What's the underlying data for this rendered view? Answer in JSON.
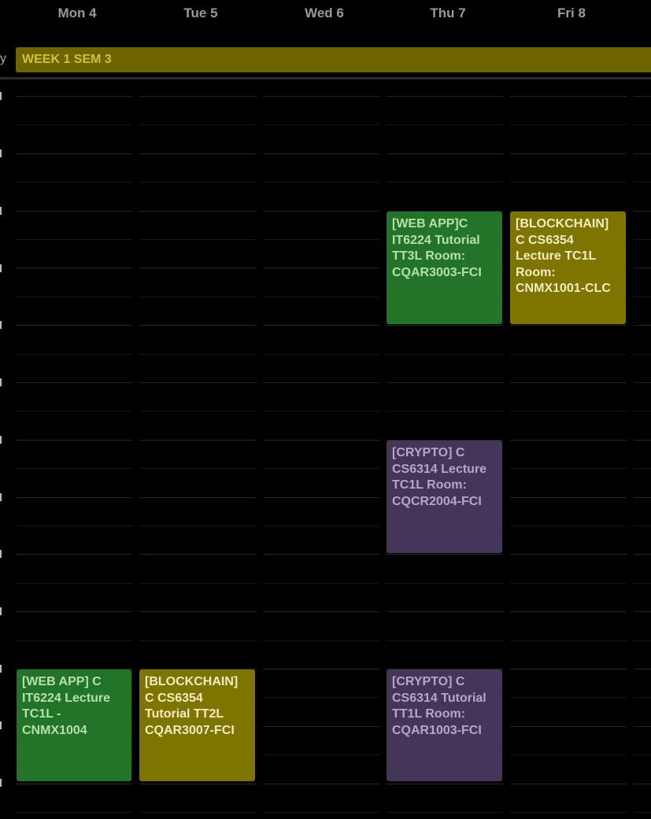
{
  "days": [
    "Mon 4",
    "Tue 5",
    "Wed 6",
    "Thu 7",
    "Fri 8"
  ],
  "all_day": {
    "label": "y",
    "event_title": "WEEK 1 SEM 3",
    "color": "#6e6400"
  },
  "events": [
    {
      "day": "Thu 7",
      "text": "[WEB APP]C IT6224 Tutorial TT3L  Room: CQAR3003-FCI",
      "color": "#237428"
    },
    {
      "day": "Fri 8",
      "text": "[BLOCKCHAIN] C CS6354 Lecture TC1L Room: CNMX1001-CLC",
      "color": "#7e7500"
    },
    {
      "day": "Thu 7",
      "text": "[CRYPTO] C CS6314 Lecture TC1L Room: CQCR2004-FCI",
      "color": "#453558"
    },
    {
      "day": "Mon 4",
      "text": "[WEB APP] C IT6224 Lecture TC1L - CNMX1004",
      "color": "#237428"
    },
    {
      "day": "Tue 5",
      "text": "[BLOCKCHAIN] C CS6354 Tutorial TT2L CQAR3007-FCI",
      "color": "#7e7500"
    },
    {
      "day": "Thu 7",
      "text": "[CRYPTO] C CS6314 Tutorial TT1L Room: CQAR1003-FCI",
      "color": "#453558"
    }
  ]
}
